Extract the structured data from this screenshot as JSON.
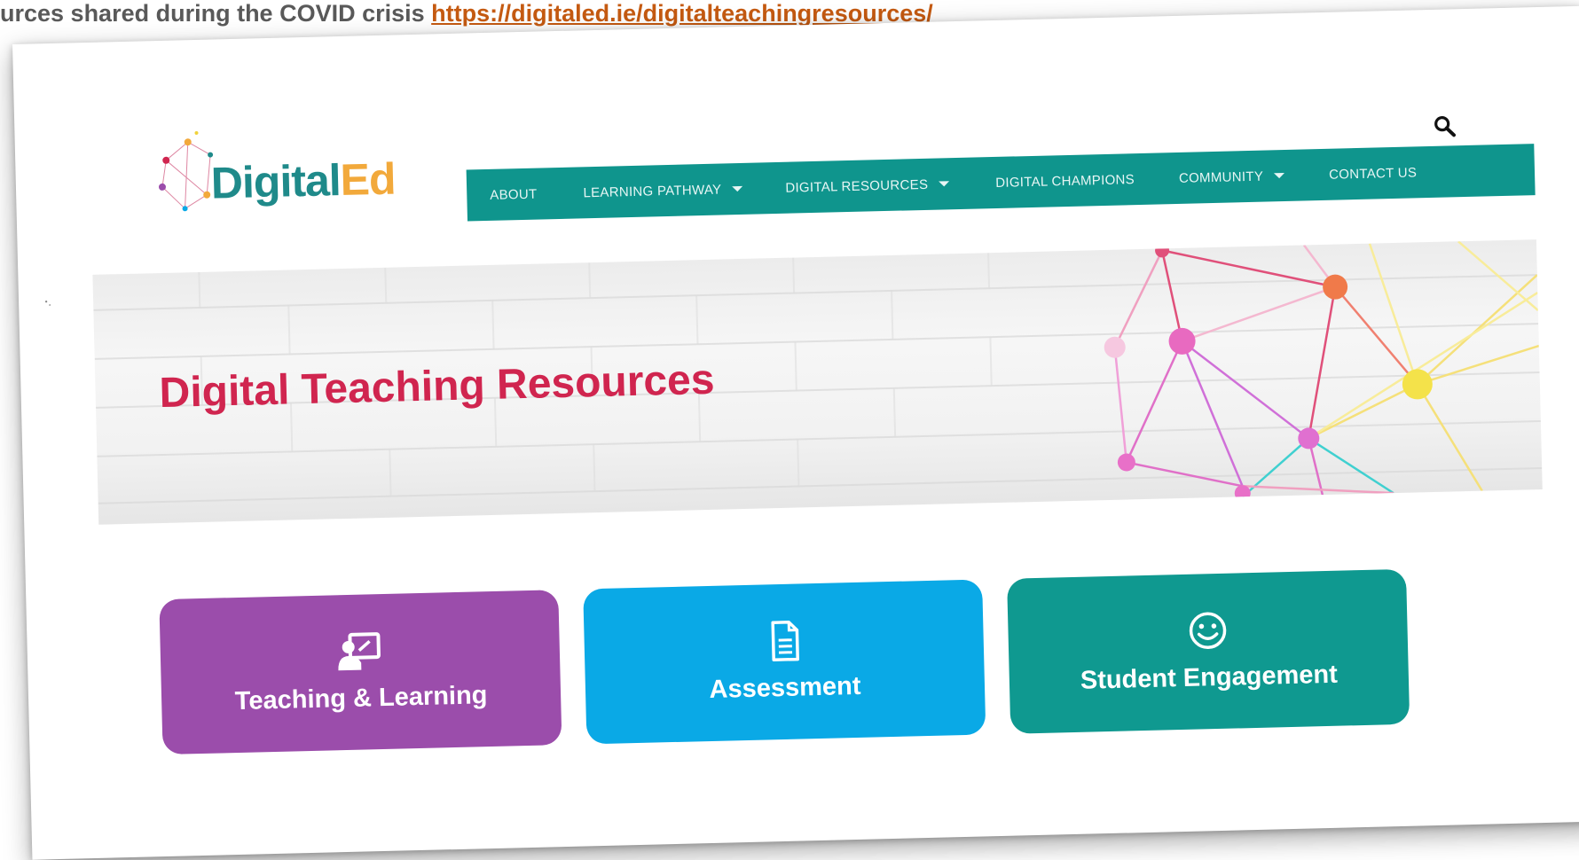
{
  "caption": {
    "text": "urces shared during the COVID crisis ",
    "link": "https://digitaled.ie/digitalteachingresources/"
  },
  "logo": {
    "part1": "Digital",
    "part2": "Ed",
    "colors": {
      "digital": "#1f8a8a",
      "ed": "#f2a93b"
    }
  },
  "header": {
    "search_icon": "search-icon"
  },
  "nav": {
    "background": "#0f958d",
    "items": [
      {
        "label": "ABOUT",
        "dropdown": false
      },
      {
        "label": "LEARNING PATHWAY",
        "dropdown": true
      },
      {
        "label": "DIGITAL RESOURCES",
        "dropdown": true
      },
      {
        "label": "DIGITAL CHAMPIONS",
        "dropdown": false
      },
      {
        "label": "COMMUNITY",
        "dropdown": true
      },
      {
        "label": "CONTACT US",
        "dropdown": false
      }
    ]
  },
  "hero": {
    "title": "Digital Teaching Resources",
    "title_color": "#d0254f"
  },
  "tiles": [
    {
      "label": "Teaching & Learning",
      "icon": "presentation-icon",
      "color": "#9b4dab"
    },
    {
      "label": "Assessment",
      "icon": "document-icon",
      "color": "#0aa9e6"
    },
    {
      "label": "Student Engagement",
      "icon": "smiley-icon",
      "color": "#0f9990"
    }
  ]
}
